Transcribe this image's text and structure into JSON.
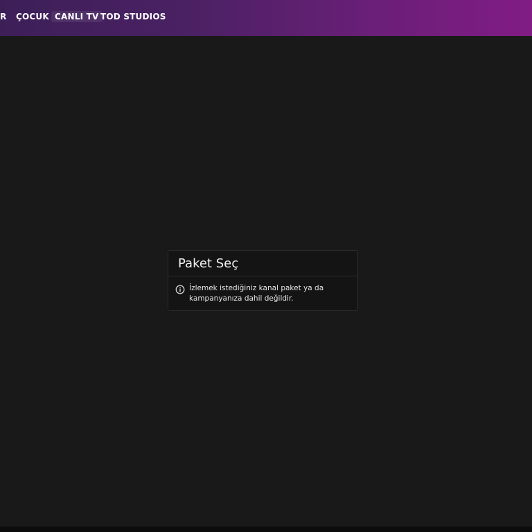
{
  "nav": {
    "items": [
      {
        "label": "R",
        "name": "nav-item-partial"
      },
      {
        "label": "ÇOCUK",
        "name": "nav-item-cocuk"
      },
      {
        "label": "CANLI TV",
        "name": "nav-item-canli-tv"
      },
      {
        "label": "TOD STUDIOS",
        "name": "nav-item-tod-studios"
      }
    ],
    "active_index": 2
  },
  "modal": {
    "title": "Paket Seç",
    "message": "İzlemek istediğiniz kanal paket ya da kampanyanıza dahil değildir.",
    "icon": "info-icon"
  },
  "colors": {
    "background": "#1a1919",
    "header_gradient_start": "#3d1f58",
    "header_gradient_end": "#811c85",
    "modal_bg": "#141414"
  }
}
